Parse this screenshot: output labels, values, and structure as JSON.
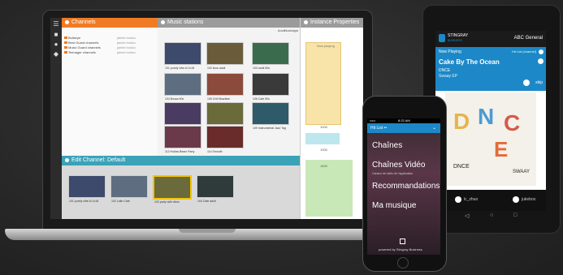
{
  "laptop": {
    "channels_panel": {
      "title": "Channels",
      "items": [
        {
          "name": "Bullseye",
          "owner": "jaimie.bolduc"
        },
        {
          "name": "Best Guard channels",
          "owner": "jaimie.bolduc"
        },
        {
          "name": "Music Guard channels",
          "owner": "jaimie.bolduc"
        },
        {
          "name": "Teenager channels",
          "owner": "jaimie.bolduc"
        }
      ]
    },
    "music_panel": {
      "title": "Music stations",
      "tabs": [
        "Adult",
        "Nostalgia"
      ],
      "thumbs": [
        {
          "label": "101 purely vibe Al 1x18"
        },
        {
          "label": "102 slow adult"
        },
        {
          "label": "103 adult 80s"
        },
        {
          "label": "104 Bossa 90s"
        },
        {
          "label": "105 Chill Brazilian"
        },
        {
          "label": "106 Cafe 50s"
        },
        {
          "label": "107 Bossa Vibes"
        },
        {
          "label": "108 Latin adult"
        },
        {
          "label": "109 Instrumental Jazz Tag"
        },
        {
          "label": "110 Cafe"
        },
        {
          "label": "111 Rock"
        },
        {
          "label": "112 Vintage Love songs"
        },
        {
          "label": "113 Hollow Beam Party"
        },
        {
          "label": "114 Smooth"
        }
      ]
    },
    "props_panel": {
      "title": "Instance Properties",
      "chart_label": "Now playing",
      "values": [
        "1000",
        "1300",
        "1400"
      ]
    },
    "edit_panel": {
      "title": "Edit Channel: Default",
      "thumbs": [
        {
          "label": "101 purely vibe Al 1x18"
        },
        {
          "label": "102 Latin Cafe"
        },
        {
          "label": "103 party with vibes"
        },
        {
          "label": "104 Cafe adult"
        }
      ]
    }
  },
  "tablet": {
    "brand": "STINGRAY",
    "brand_sub": "BUSINESS",
    "zone": "ABC General",
    "now_playing_label": "Now Playing",
    "list_label": "Hit List (channel)",
    "song_title": "Cake By The Ocean",
    "artist": "DNCE",
    "album": "Swaay EP",
    "skip_label": "skip",
    "album_art_letters": [
      "D",
      "N",
      "C",
      "E"
    ],
    "album_cover_caption": "SWAAY",
    "album_cover_brand": "DNCE",
    "footer_left": "lc_zhuo",
    "footer_right": "jukebox"
  },
  "phone": {
    "carrier": "••••• ",
    "time": "8:22 AM",
    "header": "Hit List ••",
    "menu": [
      {
        "label": "Chaînes",
        "sub": ""
      },
      {
        "label": "Chaînes Vidéo",
        "sub": "Canaux de vidéo de l'application"
      },
      {
        "label": "Recommandations",
        "sub": ""
      },
      {
        "label": "Ma musique",
        "sub": ""
      }
    ],
    "footer": "powered by Stingray Business"
  },
  "colors": {
    "accent_orange": "#f07b25",
    "accent_teal": "#3aa3b8",
    "tablet_blue": "#1c88c8"
  }
}
